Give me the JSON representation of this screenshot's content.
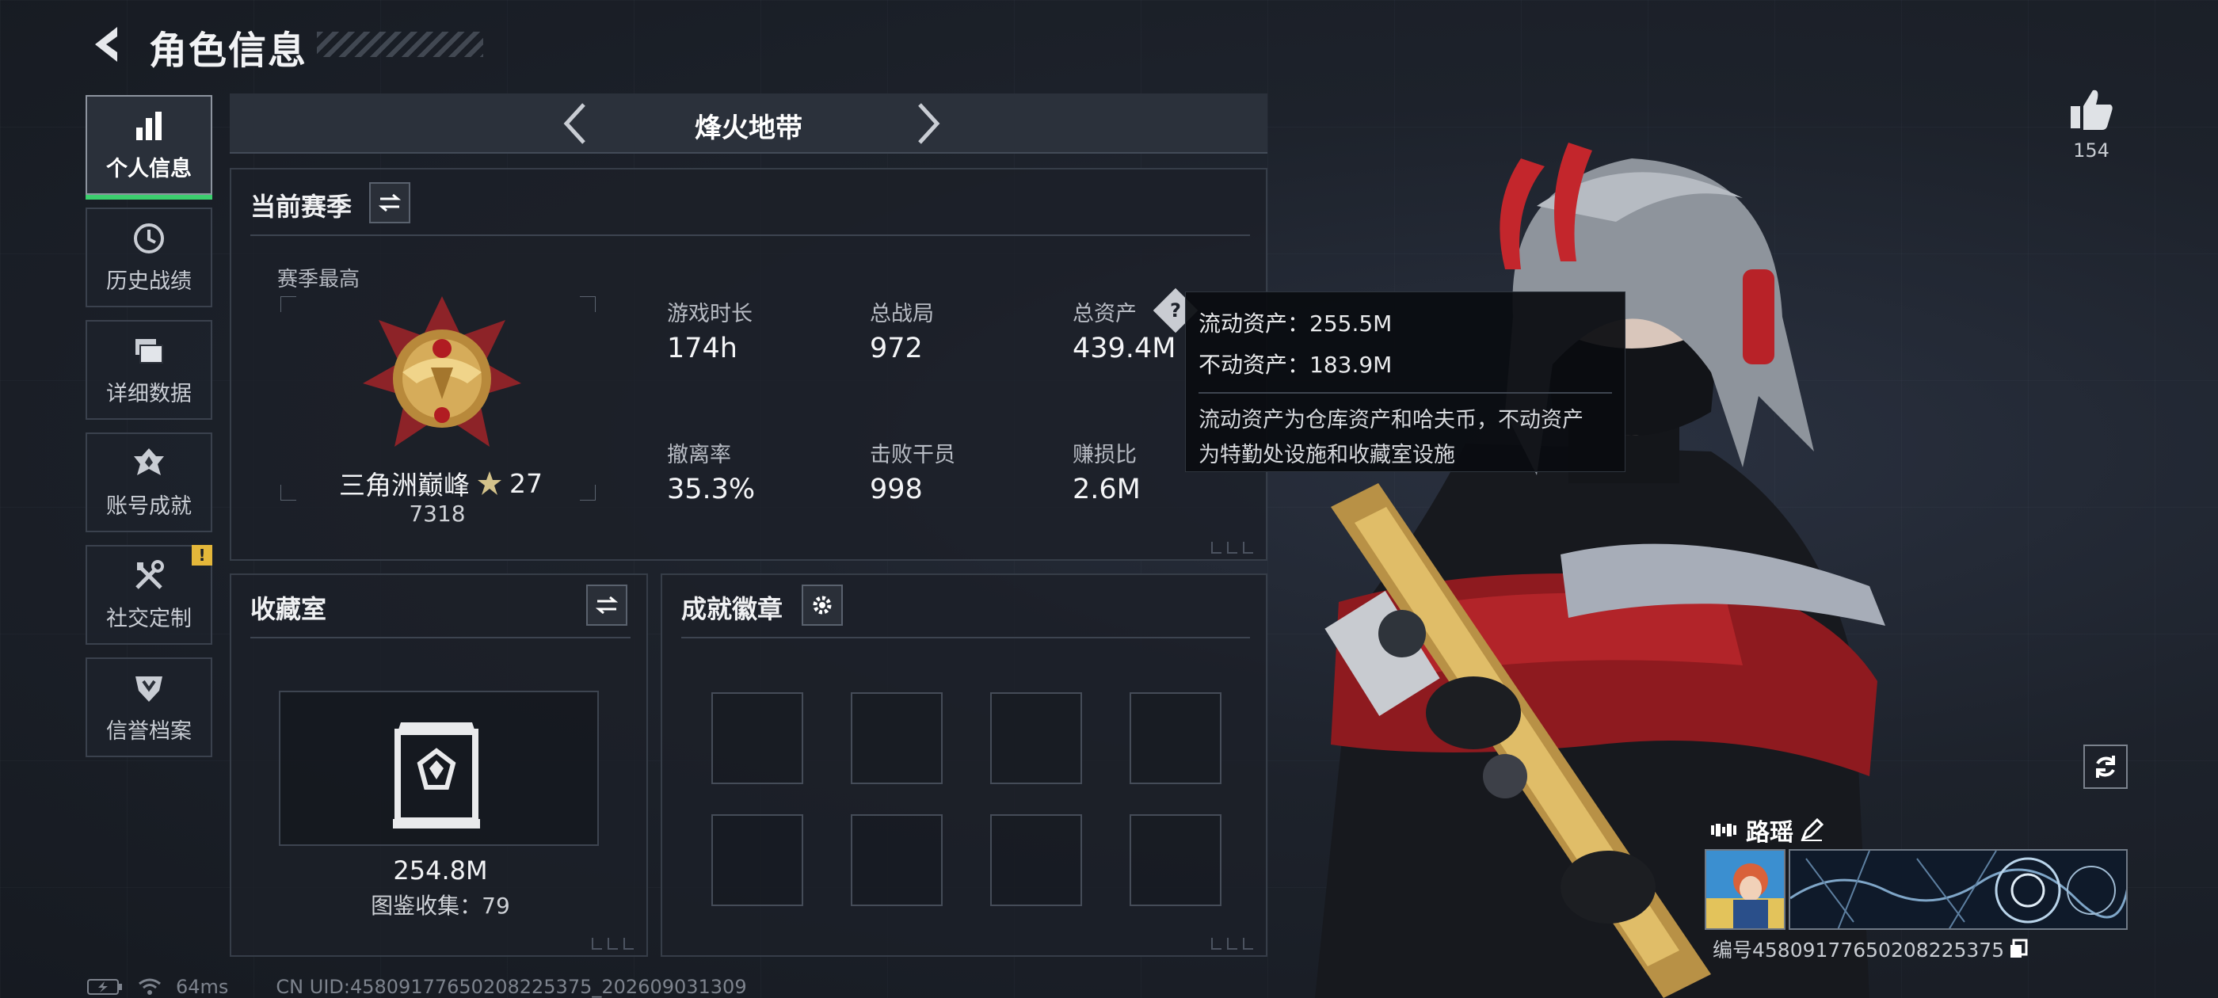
{
  "header": {
    "title": "角色信息"
  },
  "nav": {
    "items": [
      {
        "label": "个人信息",
        "icon": "bar-chart-icon",
        "active": true
      },
      {
        "label": "历史战绩",
        "icon": "history-clock-icon"
      },
      {
        "label": "详细数据",
        "icon": "folders-icon"
      },
      {
        "label": "账号成就",
        "icon": "achievement-emblem-icon"
      },
      {
        "label": "社交定制",
        "icon": "tools-icon",
        "badge": "!"
      },
      {
        "label": "信誉档案",
        "icon": "reputation-shield-icon"
      }
    ]
  },
  "mode": {
    "label": "烽火地带"
  },
  "season": {
    "title": "当前赛季",
    "best_label": "赛季最高",
    "rank_name": "三角洲巅峰",
    "rank_star_count": "27",
    "rank_score": "7318",
    "stats": [
      {
        "label": "游戏时长",
        "value": "174h"
      },
      {
        "label": "总战局",
        "value": "972"
      },
      {
        "label": "总资产",
        "value": "439.4M"
      },
      {
        "label": "撤离率",
        "value": "35.3%"
      },
      {
        "label": "击败干员",
        "value": "998"
      },
      {
        "label": "赚损比",
        "value": "2.6M"
      }
    ]
  },
  "tooltip": {
    "liquid": "流动资产：255.5M",
    "fixed": "不动资产：183.9M",
    "desc_line1": "流动资产为仓库资产和哈夫币，不动资产",
    "desc_line2": "为特勤处设施和收藏室设施"
  },
  "collection": {
    "title": "收藏室",
    "value": "254.8M",
    "count_text": "图鉴收集：79"
  },
  "badges": {
    "title": "成就徽章",
    "slot_count": 8
  },
  "likes": {
    "count": "154"
  },
  "player": {
    "name": "路瑶",
    "id_text": "编号4580917765020822537​5",
    "id_value": "编号45809177650208225375"
  },
  "status": {
    "ping": "64ms",
    "uid": "CN UID:45809177650208225375_202609031309"
  },
  "colors": {
    "accent_green": "#3ccf6e",
    "warning": "#e4b73a",
    "panel_bg": "#1c2028"
  }
}
